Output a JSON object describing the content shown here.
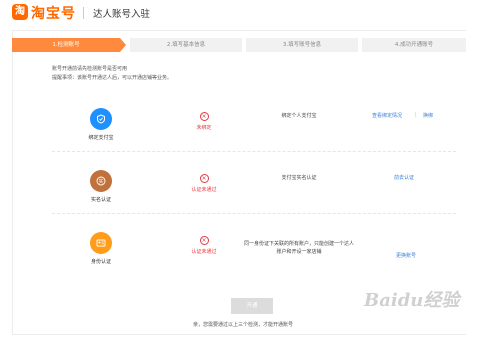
{
  "header": {
    "logo_mark": "淘",
    "logo_text": "淘宝号",
    "page_title": "达人账号入驻"
  },
  "steps": [
    {
      "label": "1.检测账号",
      "active": true
    },
    {
      "label": "2.填写基本信息",
      "active": false
    },
    {
      "label": "3.填写账号信息",
      "active": false
    },
    {
      "label": "4.成功开通账号",
      "active": false
    }
  ],
  "notice": {
    "line1": "账号开通前请先检测账号是否可用",
    "line2": "提醒事项：该账号开通达人后，可以开通店铺等业务。"
  },
  "rows": [
    {
      "icon": "alipay-shield-icon",
      "icon_color": "#1e90ff",
      "label": "绑定支付宝",
      "status": "未绑定",
      "description": "绑定个人支付宝",
      "actions": [
        "查看绑定情况",
        "换绑"
      ]
    },
    {
      "icon": "realname-icon",
      "icon_color": "#c0713c",
      "label": "实名认证",
      "status": "认证未通过",
      "description": "支付宝实名认证",
      "actions": [
        "前去认证"
      ]
    },
    {
      "icon": "id-card-icon",
      "icon_color": "#ff9d1a",
      "label": "身份认证",
      "status": "认证未通过",
      "description": "同一身份证下关联的所有账户，只能创建一个达人账户和开设一家店铺",
      "actions": [
        "更换账号"
      ]
    }
  ],
  "open_button": "开通",
  "footer_note": "亲，您需要通过以上三个检测，才能开通账号",
  "watermark": "Baidu经验"
}
